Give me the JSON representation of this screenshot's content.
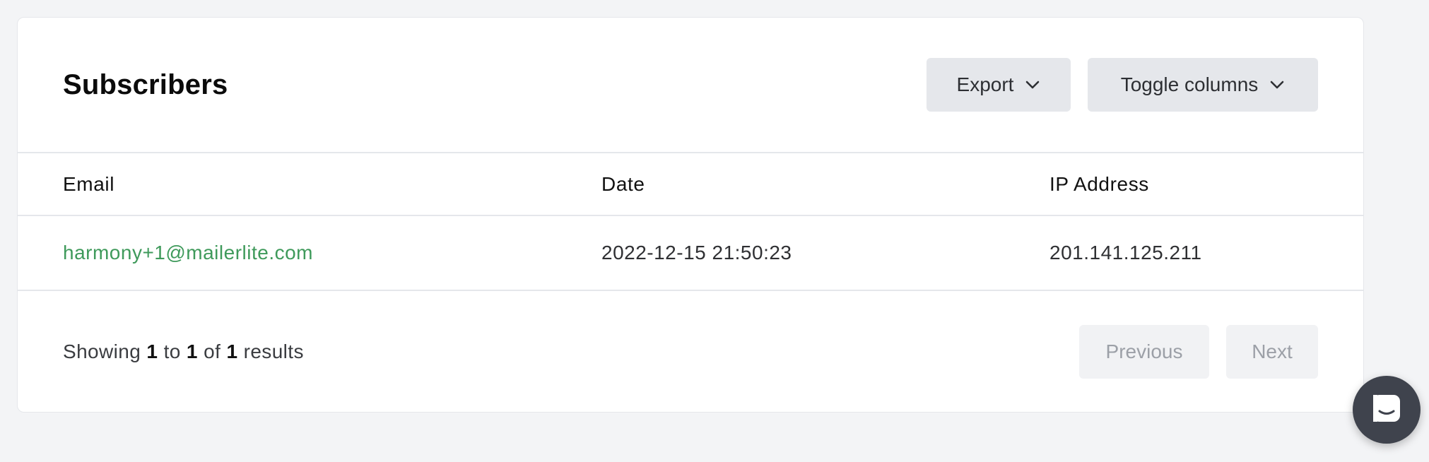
{
  "panel": {
    "title": "Subscribers",
    "export_label": "Export",
    "toggle_columns_label": "Toggle columns"
  },
  "table": {
    "columns": [
      "Email",
      "Date",
      "IP Address"
    ],
    "rows": [
      {
        "email": "harmony+1@mailerlite.com",
        "date": "2022-12-15 21:50:23",
        "ip": "201.141.125.211"
      }
    ]
  },
  "footer": {
    "showing_prefix": "Showing",
    "from": "1",
    "to_word": "to",
    "to": "1",
    "of_word": "of",
    "total": "1",
    "results_word": "results",
    "previous_label": "Previous",
    "next_label": "Next"
  },
  "icons": {
    "export_chevron": "chevron-down-icon",
    "toggle_chevron": "chevron-down-icon",
    "chat": "chat-icon"
  },
  "colors": {
    "email_link": "#3f9a5b",
    "button_bg": "#e5e7eb",
    "chat_launcher": "#3f434d"
  }
}
